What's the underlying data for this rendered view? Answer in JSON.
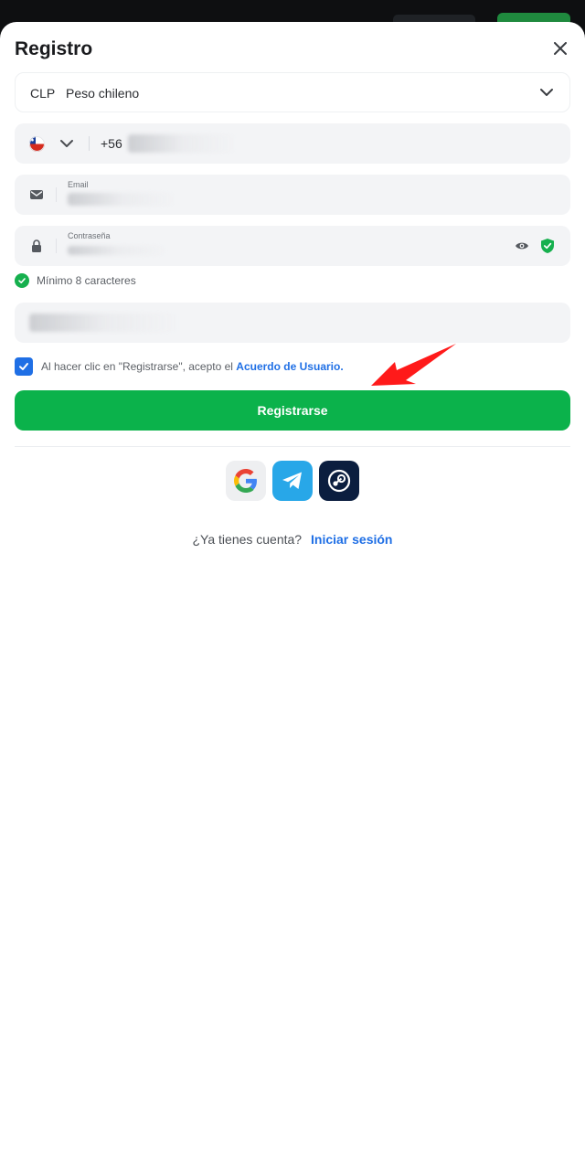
{
  "modal": {
    "title": "Registro",
    "close_icon": "close-icon"
  },
  "currency": {
    "code": "CLP",
    "name": "Peso chileno",
    "icon": "chevron-down-icon"
  },
  "phone": {
    "country_flag": "chile-flag-icon",
    "prefix": "+56"
  },
  "email": {
    "label": "Email",
    "icon": "envelope-icon"
  },
  "password": {
    "label": "Contraseña",
    "icon": "lock-icon",
    "show_icon": "eye-icon",
    "strength_icon": "shield-check-icon"
  },
  "password_hint": {
    "text": "Mínimo 8 caracteres",
    "icon": "check-circle-icon"
  },
  "terms": {
    "text": "Al hacer clic en \"Registrarse\", acepto el",
    "link": "Acuerdo de Usuario.",
    "checked": true
  },
  "submit": {
    "label": "Registrarse"
  },
  "social": [
    {
      "name": "google",
      "icon": "google-icon"
    },
    {
      "name": "telegram",
      "icon": "telegram-icon"
    },
    {
      "name": "steam",
      "icon": "steam-icon"
    }
  ],
  "login": {
    "prompt": "¿Ya tienes cuenta?",
    "link": "Iniciar sesión"
  },
  "colors": {
    "accent_green": "#0bb24b",
    "link_blue": "#1f6fe5",
    "annotation_arrow": "#ff1a1a"
  }
}
